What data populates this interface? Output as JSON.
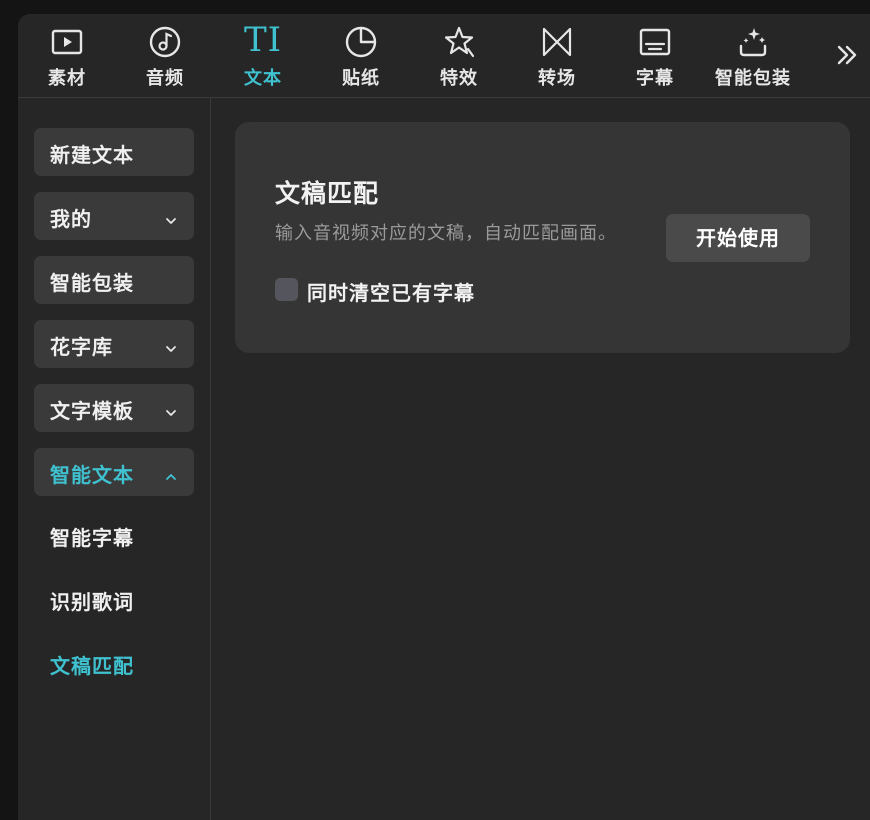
{
  "toolbar": {
    "tabs": [
      {
        "label": "素材",
        "icon": "media-play-icon"
      },
      {
        "label": "音频",
        "icon": "music-note-icon"
      },
      {
        "label": "文本",
        "icon": "text-ti-icon",
        "glyph": "TI"
      },
      {
        "label": "贴纸",
        "icon": "sticker-icon"
      },
      {
        "label": "特效",
        "icon": "effect-star-icon"
      },
      {
        "label": "转场",
        "icon": "transition-icon"
      },
      {
        "label": "字幕",
        "icon": "subtitle-icon"
      },
      {
        "label": "智能包装",
        "icon": "magic-sparkle-icon"
      }
    ],
    "active_tab": "文本",
    "more_icon": "double-chevron-right-icon"
  },
  "sidebar": {
    "items": [
      {
        "label": "新建文本",
        "chevron": null
      },
      {
        "label": "我的",
        "chevron": "down"
      },
      {
        "label": "智能包装",
        "chevron": null
      },
      {
        "label": "花字库",
        "chevron": "down"
      },
      {
        "label": "文字模板",
        "chevron": "down"
      },
      {
        "label": "智能文本",
        "chevron": "up"
      }
    ],
    "sub_items": [
      {
        "label": "智能字幕"
      },
      {
        "label": "识别歌词"
      },
      {
        "label": "文稿匹配"
      }
    ],
    "active_sub_item": "文稿匹配"
  },
  "card": {
    "title": "文稿匹配",
    "description": "输入音视频对应的文稿，自动匹配画面。",
    "start_button": "开始使用",
    "checkbox_label": "同时清空已有字幕",
    "checkbox_checked": false
  },
  "colors": {
    "accent": "#3fc1cf",
    "background": "#262626",
    "card": "#353535",
    "button": "#3a3a3a"
  }
}
